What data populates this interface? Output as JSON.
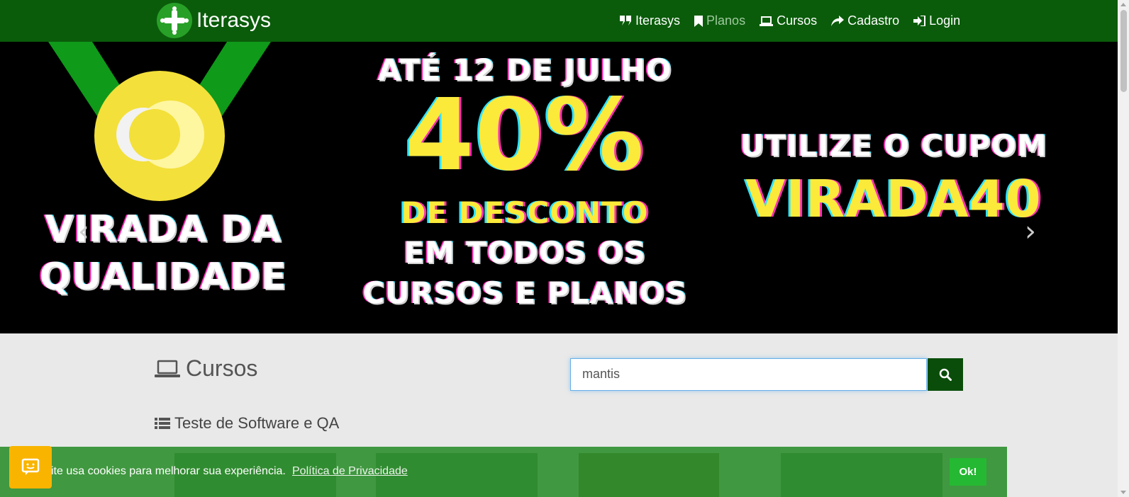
{
  "navbar": {
    "brand": "Iterasys",
    "items": [
      {
        "label": "Iterasys",
        "icon": "quote-icon",
        "active": false
      },
      {
        "label": "Planos",
        "icon": "bookmark-icon",
        "active": true
      },
      {
        "label": "Cursos",
        "icon": "laptop-icon",
        "active": false
      },
      {
        "label": "Cadastro",
        "icon": "share-icon",
        "active": false
      },
      {
        "label": "Login",
        "icon": "sign-in-icon",
        "active": false
      }
    ]
  },
  "banner": {
    "left_line1": "VIRADA DA",
    "left_line2": "QUALIDADE",
    "mid_line1": "ATÉ 12 DE JULHO",
    "mid_big": "40%",
    "mid_line2": "DE DESCONTO",
    "mid_line3": "EM TODOS OS",
    "mid_line4": "CURSOS E PLANOS",
    "right_line1": "UTILIZE O CUPOM",
    "right_code": "VIRADA40",
    "prev": "‹",
    "next": "›"
  },
  "main": {
    "title": "Cursos",
    "search_value": "mantis",
    "category": "Teste de Software e QA"
  },
  "cookie": {
    "message": "ite usa cookies para melhorar sua experiência.",
    "link": "Política de Privacidade",
    "ok": "Ok!"
  },
  "colors": {
    "navbar": "#0a5c0a",
    "accent_yellow": "#fbea3a",
    "cookie_bg": "#288c28",
    "cookie_ok": "#25b832"
  }
}
